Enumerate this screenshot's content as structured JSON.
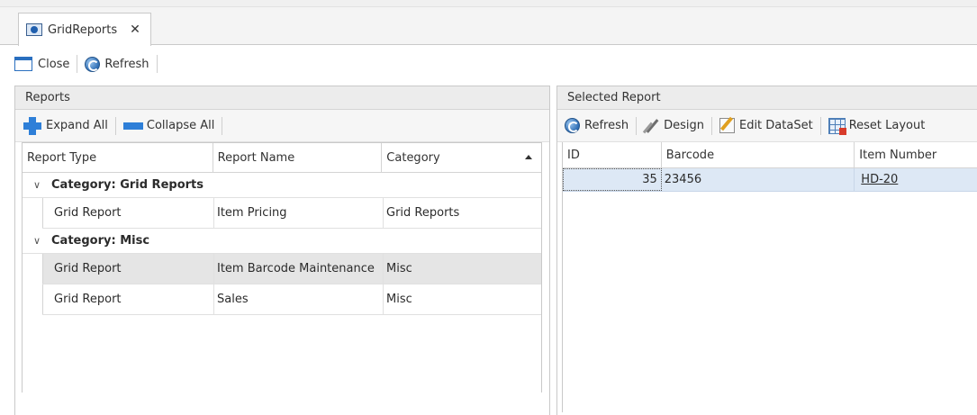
{
  "window": {
    "tab_title": "GridReports",
    "tab_close_glyph": "✕",
    "tab_icon": "report-icon"
  },
  "main_toolbar": {
    "close_label": "Close",
    "close_icon": "window-icon",
    "refresh_label": "Refresh",
    "refresh_icon": "refresh-icon"
  },
  "reports_panel": {
    "title": "Reports",
    "toolbar": {
      "expand_label": "Expand All",
      "collapse_label": "Collapse All"
    },
    "columns": [
      "Report Type",
      "Report Name",
      "Category"
    ],
    "sorted_column": "Category",
    "sort_direction": "ascending",
    "groups": [
      {
        "label": "Category: Grid Reports",
        "expanded": true,
        "rows": [
          {
            "type": "Grid Report",
            "name": "Item Pricing",
            "category": "Grid Reports"
          }
        ]
      },
      {
        "label": "Category: Misc",
        "expanded": true,
        "rows": [
          {
            "type": "Grid Report",
            "name": "Item Barcode Maintenance",
            "category": "Misc",
            "selected": true
          },
          {
            "type": "Grid Report",
            "name": "Sales",
            "category": "Misc"
          }
        ]
      }
    ],
    "expand_glyph": "∨"
  },
  "selected_panel": {
    "title": "Selected Report",
    "toolbar": {
      "refresh_label": "Refresh",
      "design_label": "Design",
      "edit_dataset_label": "Edit DataSet",
      "reset_layout_label": "Reset Layout"
    },
    "columns": [
      "ID",
      "Barcode",
      "Item Number"
    ],
    "rows": [
      {
        "id": "35",
        "barcode": "23456",
        "item_number": "HD-20"
      }
    ]
  },
  "colors": {
    "accent_blue": "#2e7fd8",
    "selected_row": "#e5e5e5",
    "focused_row": "#dde8f5",
    "panel_header": "#ececec"
  }
}
